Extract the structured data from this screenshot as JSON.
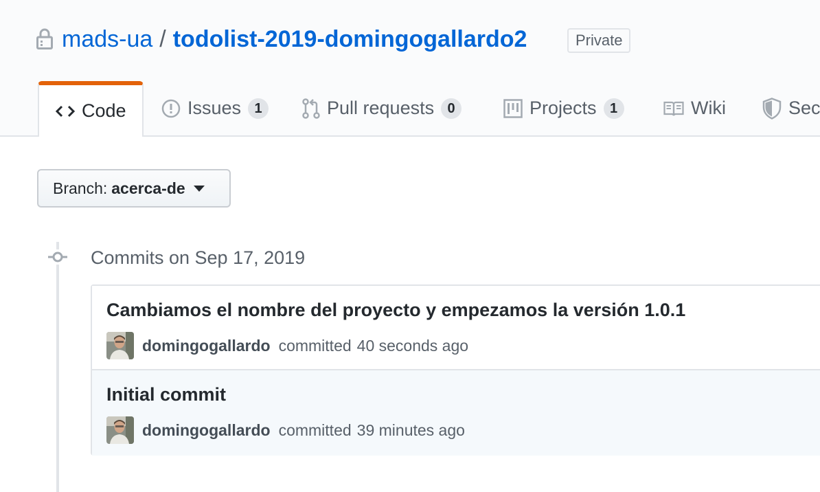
{
  "repo": {
    "owner": "mads-ua",
    "separator": "/",
    "name": "todolist-2019-domingogallardo2",
    "visibility": "Private"
  },
  "tabs": [
    {
      "label": "Code",
      "icon": "code-icon",
      "selected": true
    },
    {
      "label": "Issues",
      "icon": "issue-opened-icon",
      "count": "1"
    },
    {
      "label": "Pull requests",
      "icon": "git-pull-request-icon",
      "count": "0"
    },
    {
      "label": "Projects",
      "icon": "project-icon",
      "count": "1"
    },
    {
      "label": "Wiki",
      "icon": "book-icon"
    },
    {
      "label": "Sec",
      "icon": "shield-icon"
    }
  ],
  "branch": {
    "prefix": "Branch:",
    "name": "acerca-de"
  },
  "commit_group": {
    "title": "Commits on Sep 17, 2019"
  },
  "commits": [
    {
      "message": "Cambiamos el nombre del proyecto y empezamos la versión 1.0.1",
      "author": "domingogallardo",
      "action": "committed",
      "time": "40 seconds ago"
    },
    {
      "message": "Initial commit",
      "author": "domingogallardo",
      "action": "committed",
      "time": "39 minutes ago"
    }
  ],
  "colors": {
    "link": "#0366d6",
    "selected_tab_accent": "#e36209",
    "muted_text": "#586069",
    "border": "#e1e4e8"
  }
}
